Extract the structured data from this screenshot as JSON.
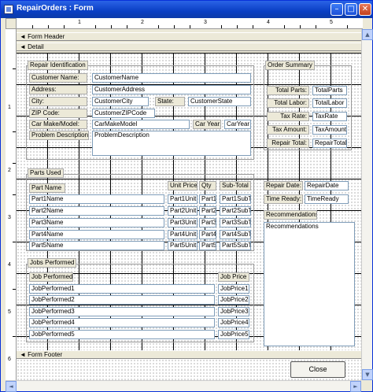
{
  "window": {
    "title": "RepairOrders : Form"
  },
  "ruler": {
    "h": [
      "1",
      "2",
      "3",
      "4",
      "5"
    ],
    "v": [
      "1",
      "2",
      "3",
      "4",
      "5",
      "6"
    ]
  },
  "sections": {
    "header": "Form Header",
    "detail": "Detail",
    "footer": "Form Footer"
  },
  "repair": {
    "group": "Repair Identification",
    "customer_name_label": "Customer Name:",
    "customer_name": "CustomerName",
    "address_label": "Address:",
    "address": "CustomerAddress",
    "city_label": "City:",
    "city": "CustomerCity",
    "state_label": "State:",
    "state": "CustomerState",
    "zip_label": "ZIP Code:",
    "zip": "CustomerZIPCode",
    "make_label": "Car Make/Model:",
    "make": "CarMakeModel",
    "year_label": "Car Year:",
    "year": "CarYear",
    "problem_label": "Problem Description:",
    "problem": "ProblemDescription"
  },
  "summary": {
    "group": "Order Summary",
    "total_parts_label": "Total Parts:",
    "total_parts": "TotalParts",
    "total_labor_label": "Total Labor:",
    "total_labor": "TotalLabor",
    "tax_rate_label": "Tax Rate:",
    "tax_rate": "TaxRate",
    "tax_amount_label": "Tax Amount:",
    "tax_amount": "TaxAmount",
    "repair_total_label": "Repair Total:",
    "repair_total": "RepairTotal"
  },
  "parts": {
    "group": "Parts Used",
    "headers": {
      "name": "Part Name",
      "unit_price": "Unit Price",
      "qty": "Qty",
      "subtotal": "Sub-Total"
    },
    "rows": [
      {
        "name": "Part1Name",
        "unit": "Part1Unit",
        "qty": "Part1",
        "sub": "Part1SubT"
      },
      {
        "name": "Part2Name",
        "unit": "Part2Unit",
        "qty": "Part2",
        "sub": "Part2SubT"
      },
      {
        "name": "Part3Name",
        "unit": "Part3Unit",
        "qty": "Part3",
        "sub": "Part3SubT"
      },
      {
        "name": "Part4Name",
        "unit": "Part4Unit",
        "qty": "Part4",
        "sub": "Part4SubT"
      },
      {
        "name": "Part5Name",
        "unit": "Part5Unit",
        "qty": "Part5",
        "sub": "Part5SubT"
      }
    ]
  },
  "dates": {
    "repair_date_label": "Repair Date:",
    "repair_date": "RepairDate",
    "time_ready_label": "Time Ready:",
    "time_ready": "TimeReady",
    "recommendations_label": "Recommendations",
    "recommendations": "Recommendations"
  },
  "jobs": {
    "group": "Jobs Performed",
    "headers": {
      "job": "Job Performed",
      "price": "Job Price"
    },
    "rows": [
      {
        "job": "JobPerformed1",
        "price": "JobPrice1"
      },
      {
        "job": "JobPerformed2",
        "price": "JobPrice2"
      },
      {
        "job": "JobPerformed3",
        "price": "JobPrice3"
      },
      {
        "job": "JobPerformed4",
        "price": "JobPrice4"
      },
      {
        "job": "JobPerformed5",
        "price": "JobPrice5"
      }
    ]
  },
  "footer": {
    "close_label": "Close"
  },
  "icons": {
    "app": "form-icon",
    "minimize": "minimize-icon",
    "maximize": "maximize-icon",
    "close": "close-icon",
    "section": "section-arrow-icon"
  }
}
